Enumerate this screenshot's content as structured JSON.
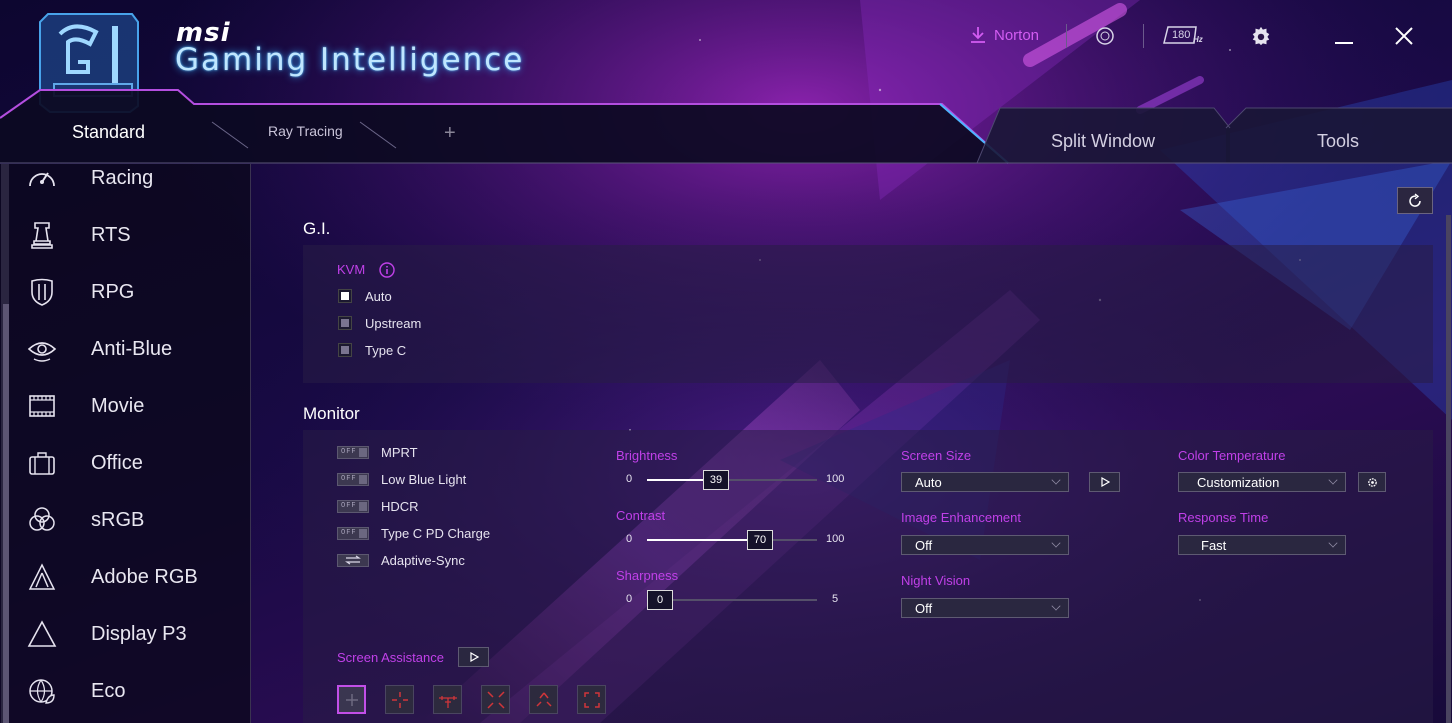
{
  "app": {
    "brand": "msi",
    "product": "Gaming Intelligence"
  },
  "topbar": {
    "norton_label": "Norton",
    "refresh_rate_badge": "180",
    "refresh_unit": "Hz"
  },
  "tabs": [
    {
      "label": "Standard",
      "active": true
    },
    {
      "label": "Ray Tracing",
      "active": false
    },
    {
      "label": "+",
      "active": false
    },
    {
      "label": "Split Window",
      "active": false
    },
    {
      "label": "Tools",
      "active": false
    }
  ],
  "sidebar": {
    "items": [
      {
        "label": "Racing",
        "icon": "speedometer-icon"
      },
      {
        "label": "RTS",
        "icon": "chess-rook-icon"
      },
      {
        "label": "RPG",
        "icon": "shield-sword-icon"
      },
      {
        "label": "Anti-Blue",
        "icon": "eye-icon"
      },
      {
        "label": "Movie",
        "icon": "film-icon"
      },
      {
        "label": "Office",
        "icon": "briefcase-icon"
      },
      {
        "label": "sRGB",
        "icon": "color-circles-icon"
      },
      {
        "label": "Adobe RGB",
        "icon": "adobe-triangle-icon"
      },
      {
        "label": "Display P3",
        "icon": "triangle-icon"
      },
      {
        "label": "Eco",
        "icon": "globe-leaf-icon"
      }
    ]
  },
  "gi": {
    "title": "G.I.",
    "kvm_label": "KVM",
    "kvm_options": [
      {
        "label": "Auto",
        "selected": true
      },
      {
        "label": "Upstream",
        "selected": false
      },
      {
        "label": "Type C",
        "selected": false
      }
    ]
  },
  "monitor": {
    "title": "Monitor",
    "toggles": [
      {
        "label": "MPRT",
        "state": "OFF"
      },
      {
        "label": "Low Blue Light",
        "state": "OFF"
      },
      {
        "label": "HDCR",
        "state": "OFF"
      },
      {
        "label": "Type C PD Charge",
        "state": "OFF"
      },
      {
        "label": "Adaptive-Sync",
        "state": "sync"
      }
    ],
    "sliders": {
      "brightness": {
        "label": "Brightness",
        "min": "0",
        "max": "100",
        "value": "39"
      },
      "contrast": {
        "label": "Contrast",
        "min": "0",
        "max": "100",
        "value": "70"
      },
      "sharpness": {
        "label": "Sharpness",
        "min": "0",
        "max": "5",
        "value": "0"
      }
    },
    "screen_size": {
      "label": "Screen Size",
      "value": "Auto"
    },
    "image_enhancement": {
      "label": "Image Enhancement",
      "value": "Off"
    },
    "night_vision": {
      "label": "Night Vision",
      "value": "Off"
    },
    "color_temperature": {
      "label": "Color Temperature",
      "value": "Customization"
    },
    "response_time": {
      "label": "Response Time",
      "value": "Fast"
    },
    "screen_assistance": {
      "label": "Screen Assistance",
      "selected_index": 0,
      "count": 6
    }
  },
  "colors": {
    "accent_purple": "#c040e8",
    "header_glow": "#2fa8ff",
    "crosshair_red": "#d0353a"
  }
}
